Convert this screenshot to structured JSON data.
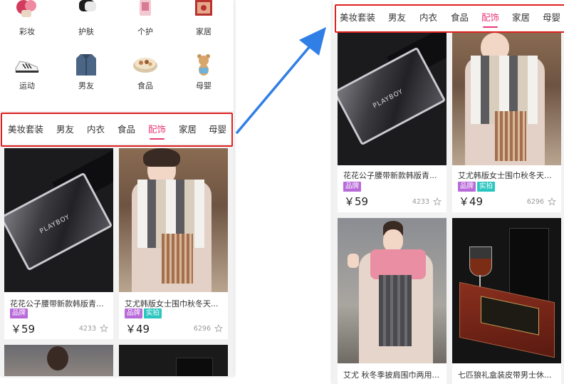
{
  "categories": [
    {
      "label": "彩妆",
      "icon": "makeup-icon"
    },
    {
      "label": "护肤",
      "icon": "skincare-icon"
    },
    {
      "label": "个护",
      "icon": "personal-care-icon"
    },
    {
      "label": "家居",
      "icon": "home-goods-icon"
    },
    {
      "label": "运动",
      "icon": "sneaker-icon"
    },
    {
      "label": "男友",
      "icon": "jacket-icon"
    },
    {
      "label": "食品",
      "icon": "cookie-box-icon"
    },
    {
      "label": "母婴",
      "icon": "teddy-bear-icon"
    }
  ],
  "tabs": [
    "美妆套装",
    "男友",
    "内衣",
    "食品",
    "配饰",
    "家居",
    "母婴"
  ],
  "active_tab": "配饰",
  "products": [
    {
      "title": "花花公子腰带新款韩版青...",
      "badges": [
        "品牌"
      ],
      "price": "￥59",
      "likes": "4233",
      "image_text": "PLAYBOY"
    },
    {
      "title": "艾尤韩版女士围巾秋冬天...",
      "badges": [
        "品牌",
        "实拍"
      ],
      "price": "￥49",
      "likes": "6296"
    },
    {
      "title": "艾尤 秋冬季披肩围巾两用..."
    },
    {
      "title": "七匹狼礼盒装皮带男士休..."
    }
  ],
  "colors": {
    "accent": "#e8387a",
    "highlight_box": "#e02020",
    "arrow": "#2f7fe6",
    "badge_brand": "#b86ad8",
    "badge_real": "#2cc6c1"
  }
}
